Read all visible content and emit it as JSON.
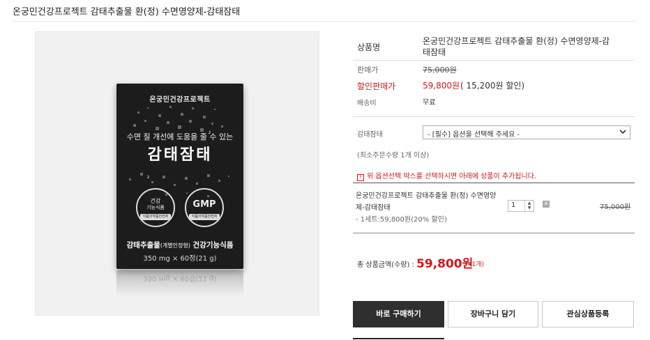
{
  "page": {
    "title": "온궁민건강프로젝트 감태추출물 환(정) 수면영양제-감태잠태"
  },
  "product_image": {
    "brand": "온궁민건강프로젝트",
    "tagline": "수면 질 개선에 도움을 줄 수 있는",
    "name": "감태잠태",
    "seal_left_line1": "건강",
    "seal_left_line2": "기능식품",
    "seal_left_band": "식품의약품안전처",
    "seal_right_text": "GMP",
    "seal_right_band": "식품의약품안전처",
    "desc_main": "감태추출물",
    "desc_small": "(개별인정형)",
    "desc_tail": " 건강기능식품",
    "qty": "350 mg × 60정(21 g)",
    "reflection": "350 mg × 60정(21 g)"
  },
  "info": {
    "name_label": "상품명",
    "name_value_line1": "온궁민건강프로젝트 감태추출물 환(정) 수면영양제-감",
    "name_value_line2": "태잠태",
    "price_label": "판매가",
    "price_value": "75,000원",
    "sale_label": "할인판매가",
    "sale_value": "59,800원",
    "sale_discount": "( 15,200원 할인)",
    "shipping_label": "배송비",
    "shipping_value": "무료"
  },
  "option": {
    "label": "감태잠태",
    "select_value": "- [필수] 옵션을 선택해 주세요 -",
    "min_order": "(최소주문수량 1개 이상)",
    "notice": "위 옵션선택 박스를 선택하시면 아래에 상품이 추가됩니다."
  },
  "selected": {
    "name_line1": "온궁민건강프로젝트 감태추출물 환(정) 수면영양",
    "name_line2": "제-감태잠태",
    "detail": "- 1세트:59,800원(20% 할인)",
    "quantity": "1",
    "price": "75,000원"
  },
  "total": {
    "label": "총 상품금액(수량) : ",
    "amount": "59,800원",
    "count": "(1개)"
  },
  "buttons": {
    "buy": "바로 구매하기",
    "cart": "장바구니 담기",
    "wish": "관심상품등록"
  },
  "colors": {
    "accent_red": "#d0181a",
    "primary_button": "#2f2f2f"
  }
}
